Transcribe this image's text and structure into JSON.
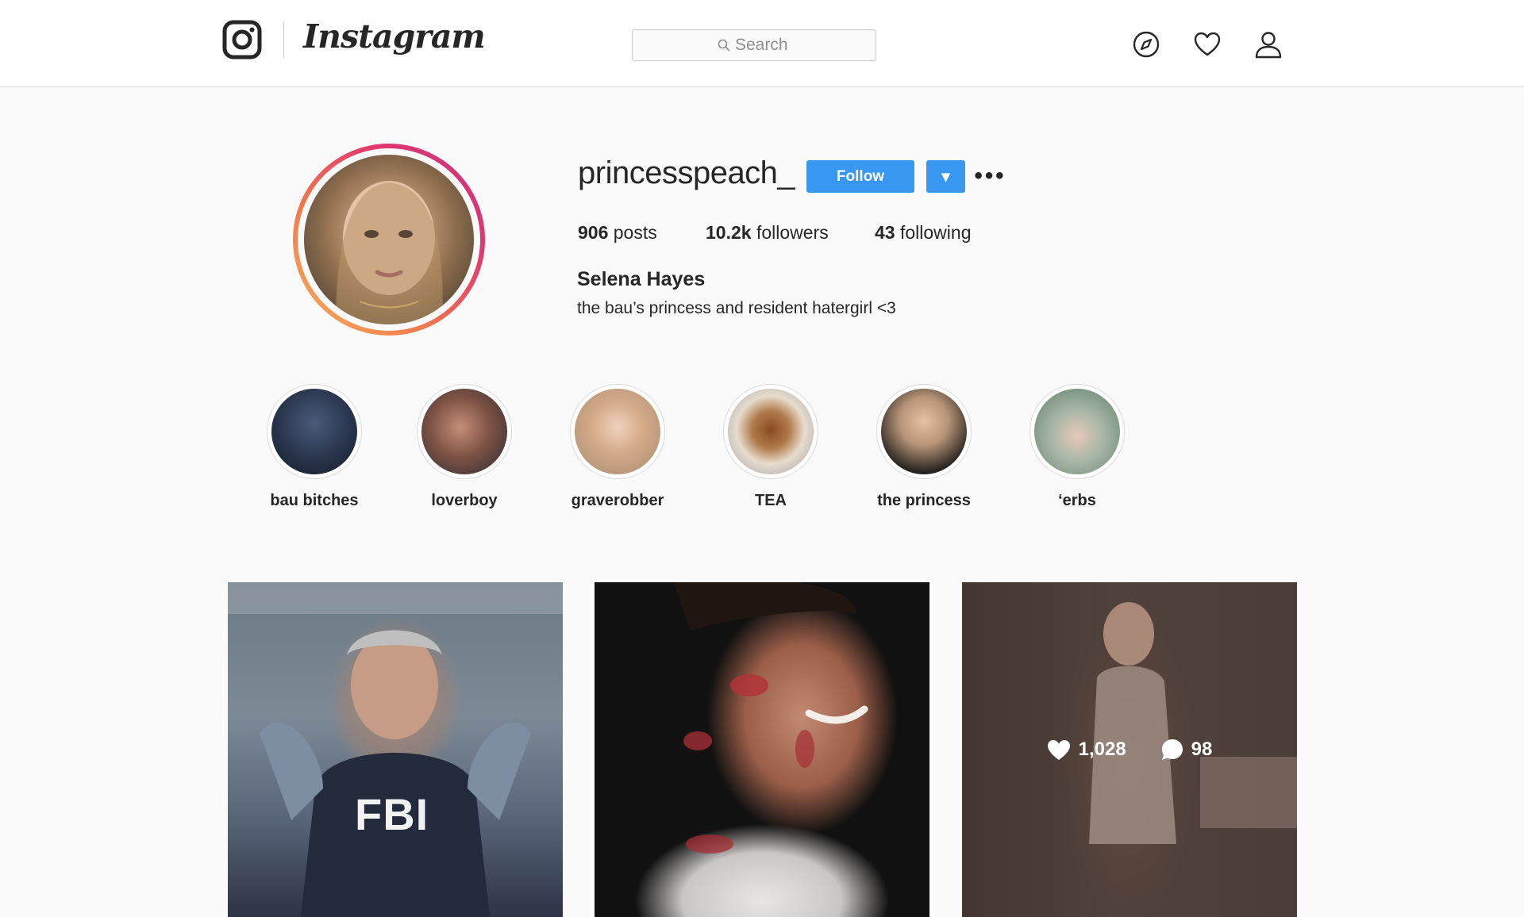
{
  "header": {
    "wordmark": "Instagram",
    "search": {
      "placeholder": "Search"
    }
  },
  "profile": {
    "username": "princesspeach_",
    "follow_label": "Follow",
    "dropdown_glyph": "▼",
    "more_glyph": "•••",
    "stats": {
      "posts_count": "906",
      "posts_label": "posts",
      "followers_count": "10.2k",
      "followers_label": "followers",
      "following_count": "43",
      "following_label": "following"
    },
    "full_name": "Selena Hayes",
    "bio": "the bau’s princess and resident hatergirl <3"
  },
  "highlights": [
    {
      "label": "bau bitches"
    },
    {
      "label": "loverboy"
    },
    {
      "label": "graverobber"
    },
    {
      "label": "TEA"
    },
    {
      "label": "the princess"
    },
    {
      "label": "‘erbs"
    }
  ],
  "posts": [
    {
      "caption_text": "FBI"
    },
    {},
    {
      "likes": "1,028",
      "comments": "98"
    }
  ],
  "colors": {
    "accent": "#3897f0",
    "ring_start": "#f9b35f",
    "ring_end": "#c13584"
  },
  "icons": [
    "instagram-logo-icon",
    "search-icon",
    "compass-icon",
    "heart-icon",
    "user-icon",
    "comment-icon"
  ]
}
